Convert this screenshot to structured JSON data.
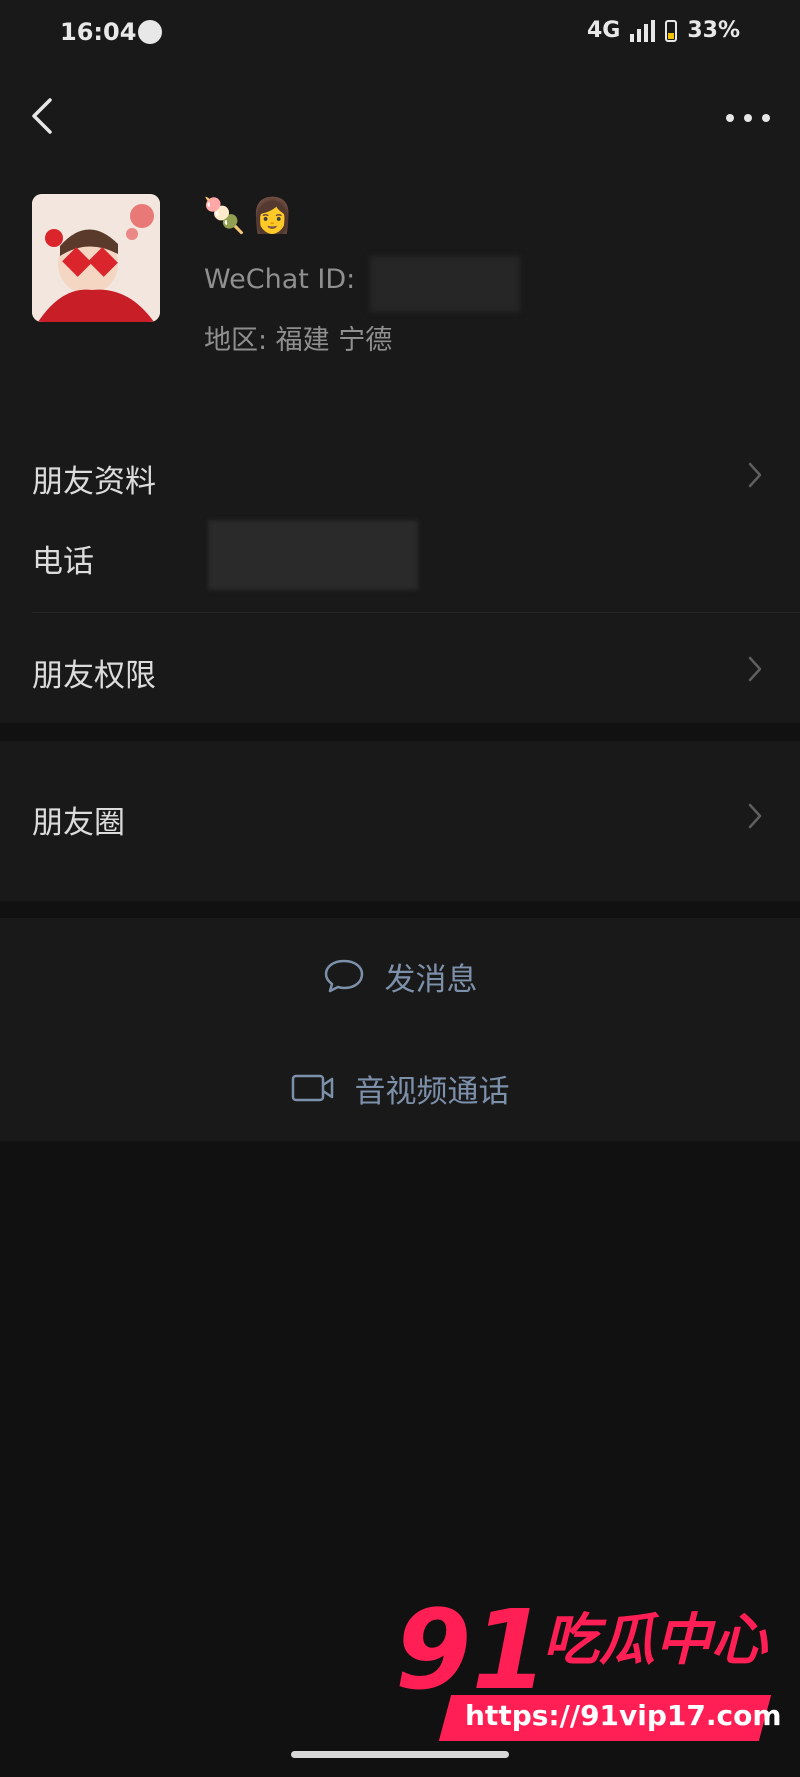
{
  "status_bar": {
    "time": "16:04",
    "network": "4G",
    "battery": "33%"
  },
  "profile": {
    "nickname_emoji": "🍡👩",
    "wechat_id_label": "WeChat ID:",
    "region": "地区: 福建 宁德"
  },
  "info": {
    "friend_profile": "朋友资料",
    "phone": "电话",
    "friend_permissions": "朋友权限"
  },
  "moments": {
    "label": "朋友圈"
  },
  "actions": {
    "send_message": "发消息",
    "video_call": "音视频通话"
  },
  "watermark": {
    "number": "91",
    "name": "吃瓜中心",
    "url": "https://91vip17.com"
  },
  "colors": {
    "background": "#111111",
    "panel": "#191919",
    "action_text": "#7d90aa",
    "watermark": "#ff1f55"
  }
}
